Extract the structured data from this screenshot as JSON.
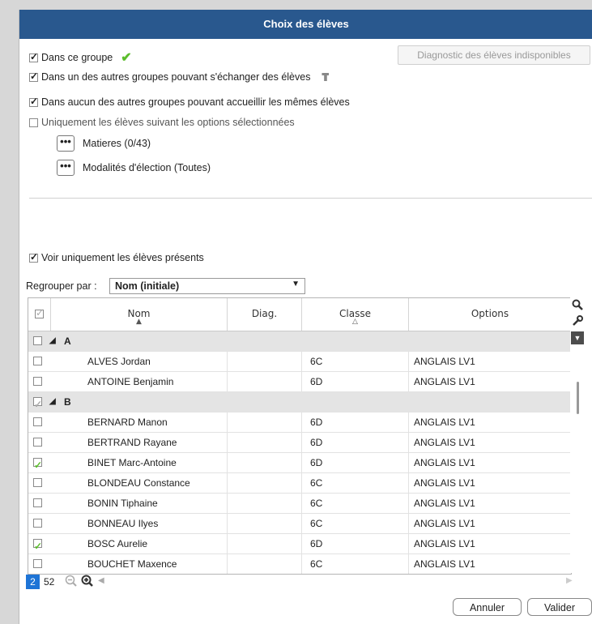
{
  "dialog": {
    "title": "Choix des élèves"
  },
  "options": {
    "dans_ce_groupe": {
      "label": "Dans ce groupe",
      "checked": true
    },
    "autres_echanger": {
      "label": "Dans un des autres groupes pouvant s'échanger des élèves",
      "checked": true
    },
    "aucun_autres": {
      "label": "Dans aucun des autres groupes pouvant accueillir les mêmes élèves",
      "checked": true
    },
    "uniquement_options": {
      "label": "Uniquement les élèves suivant les options sélectionnées",
      "checked": false
    },
    "matieres_label": "Matieres (0/43)",
    "modalites_label": "Modalités d'élection (Toutes)",
    "dots": "•••"
  },
  "diagnostic_button": "Diagnostic des élèves indisponibles",
  "voir_presents": {
    "label": "Voir uniquement les élèves présents",
    "checked": true
  },
  "regrouper": {
    "label": "Regrouper par :",
    "value": "Nom (initiale)"
  },
  "grid": {
    "columns": {
      "nom": "Nom",
      "diag": "Diag.",
      "classe": "Classe",
      "options": "Options"
    },
    "groups": [
      {
        "letter": "A",
        "rows": [
          {
            "name": "ALVES Jordan",
            "classe": "6C",
            "options": "ANGLAIS LV1",
            "state": "unchecked"
          },
          {
            "name": "ANTOINE Benjamin",
            "classe": "6D",
            "options": "ANGLAIS LV1",
            "state": "unchecked"
          }
        ]
      },
      {
        "letter": "B",
        "rows": [
          {
            "name": "BERNARD Manon",
            "classe": "6D",
            "options": "ANGLAIS LV1",
            "state": "unchecked"
          },
          {
            "name": "BERTRAND Rayane",
            "classe": "6D",
            "options": "ANGLAIS LV1",
            "state": "unchecked"
          },
          {
            "name": "BINET Marc-Antoine",
            "classe": "6D",
            "options": "ANGLAIS LV1",
            "state": "green"
          },
          {
            "name": "BLONDEAU Constance",
            "classe": "6C",
            "options": "ANGLAIS LV1",
            "state": "unchecked"
          },
          {
            "name": "BONIN Tiphaine",
            "classe": "6C",
            "options": "ANGLAIS LV1",
            "state": "unchecked"
          },
          {
            "name": "BONNEAU Ilyes",
            "classe": "6C",
            "options": "ANGLAIS LV1",
            "state": "unchecked"
          },
          {
            "name": "BOSC Aurelie",
            "classe": "6D",
            "options": "ANGLAIS LV1",
            "state": "green"
          },
          {
            "name": "BOUCHET Maxence",
            "classe": "6C",
            "options": "ANGLAIS LV1",
            "state": "unchecked"
          }
        ]
      }
    ]
  },
  "footer": {
    "selected_count": "2",
    "total_count": "52"
  },
  "buttons": {
    "cancel": "Annuler",
    "ok": "Valider"
  },
  "colors": {
    "title_bar": "#29588e",
    "accent_green": "#5bbd2b",
    "badge_blue": "#1e74d6"
  }
}
